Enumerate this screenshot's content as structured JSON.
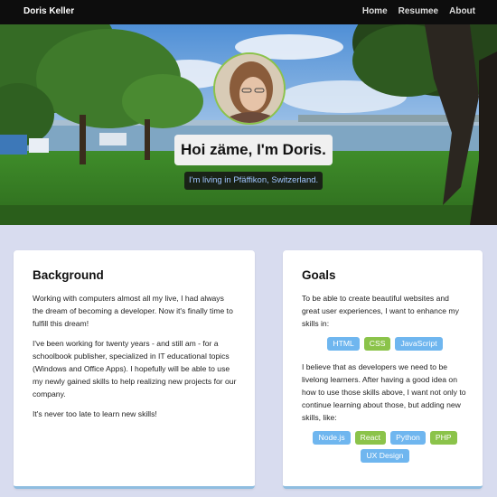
{
  "nav": {
    "brand": "Doris Keller",
    "links": [
      "Home",
      "Resumee",
      "About"
    ]
  },
  "hero": {
    "headline": "Hoi zäme, I'm Doris.",
    "subline": "I'm living in Pfäffikon, Switzerland."
  },
  "background_card": {
    "title": "Background",
    "paragraphs": [
      "Working with computers almost all my live, I had always the dream of becoming a developer. Now it's finally time to fulfill this dream!",
      "I've been working for twenty years - and still am - for a schoolbook publisher, specialized in IT educational topics (Windows and Office Apps). I hopefully will be able to use my newly gained skills to help realizing new projects for our company.",
      "It's never too late to learn new skills!"
    ]
  },
  "goals_card": {
    "title": "Goals",
    "intro": "To be able to create beautiful websites and great user experiences, I want to enhance my skills in:",
    "skills": [
      {
        "label": "HTML",
        "color": "blue"
      },
      {
        "label": "CSS",
        "color": "green"
      },
      {
        "label": "JavaScript",
        "color": "blue"
      }
    ],
    "middle": "I believe that as developers we need to be livelong learners. After having a good idea on how to use those skills above, I want not only to continue learning about those, but adding new skills, like:",
    "new_skills": [
      {
        "label": "Node.js",
        "color": "blue"
      },
      {
        "label": "React",
        "color": "green"
      },
      {
        "label": "Python",
        "color": "blue"
      },
      {
        "label": "PHP",
        "color": "green"
      },
      {
        "label": "UX Design",
        "color": "blue"
      }
    ]
  }
}
